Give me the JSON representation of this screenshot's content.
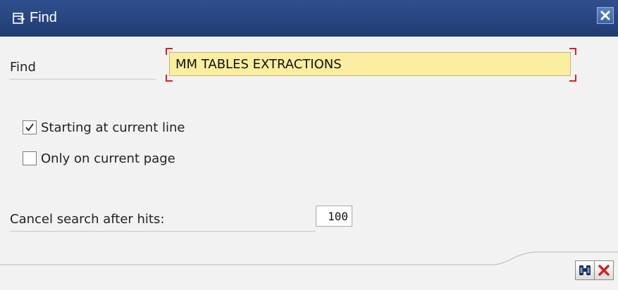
{
  "window": {
    "title": "Find",
    "title_icon": "find-dialog-icon",
    "close_icon": "close-icon"
  },
  "find": {
    "label": "Find",
    "value": "MM TABLES EXTRACTIONS",
    "required_indicator_color": "#e02020",
    "field_color": "#fbeea1"
  },
  "options": [
    {
      "label": "Starting at current line",
      "checked": true
    },
    {
      "label": "Only on current page",
      "checked": false
    }
  ],
  "hits": {
    "label": "Cancel search after hits:",
    "value": "100"
  },
  "toolbar": {
    "find_icon": "binoculars-icon",
    "cancel_icon": "cancel-icon"
  },
  "colors": {
    "titlebar": "#2a4680",
    "background": "#f2f2f2"
  }
}
